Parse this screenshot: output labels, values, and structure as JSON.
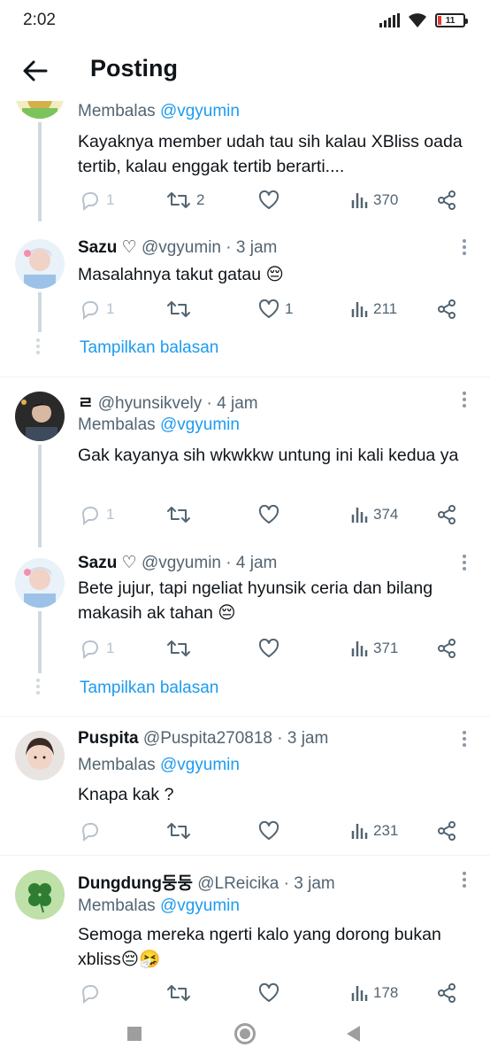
{
  "status_bar": {
    "time": "2:02",
    "battery": "11"
  },
  "header": {
    "title": "Posting"
  },
  "replies": [
    {
      "replying_prefix": "Membalas",
      "replying_handle": "@vgyumin",
      "text": "Kayaknya member udah tau sih kalau XBliss oada tertib, kalau enggak tertib berarti....",
      "stats": {
        "replies": "1",
        "retweets": "2",
        "likes": "",
        "views": "370"
      }
    },
    {
      "name": "Sazu ♡",
      "handle": "@vgyumin",
      "time": "· 3 jam",
      "text": "Masalahnya takut gatau 😔",
      "stats": {
        "replies": "1",
        "retweets": "",
        "likes": "1",
        "views": "211"
      },
      "show_replies": "Tampilkan balasan"
    },
    {
      "name": "ㄹ",
      "handle": "@hyunsikvely",
      "time": "· 4 jam",
      "replying_prefix": "Membalas",
      "replying_handle": "@vgyumin",
      "text": "Gak kayanya sih wkwkkw untung ini kali kedua ya",
      "stats": {
        "replies": "1",
        "retweets": "",
        "likes": "",
        "views": "374"
      }
    },
    {
      "name": "Sazu ♡",
      "handle": "@vgyumin",
      "time": "· 4 jam",
      "text": "Bete jujur, tapi ngeliat hyunsik ceria dan bilang makasih ak tahan 😔",
      "stats": {
        "replies": "1",
        "retweets": "",
        "likes": "",
        "views": "371"
      },
      "show_replies": "Tampilkan balasan"
    },
    {
      "name": "Puspita",
      "handle": "@Puspita270818",
      "time": "· 3 jam",
      "replying_prefix": "Membalas",
      "replying_handle": "@vgyumin",
      "text": "Knapa kak ?",
      "stats": {
        "replies": "",
        "retweets": "",
        "likes": "",
        "views": "231"
      }
    },
    {
      "name": "Dungdung둥둥",
      "handle": "@LReicika",
      "time": "· 3 jam",
      "replying_prefix": "Membalas",
      "replying_handle": "@vgyumin",
      "text": "Semoga mereka ngerti kalo yang dorong bukan xbliss😔🤧",
      "stats": {
        "replies": "",
        "retweets": "",
        "likes": "",
        "views": "178"
      }
    }
  ],
  "colors": {
    "accent": "#1d9bf0",
    "text": "#0f1419",
    "muted": "#536471",
    "thread": "#cfd9de"
  },
  "icons": [
    "back-arrow-icon",
    "reply-icon",
    "retweet-icon",
    "like-icon",
    "views-icon",
    "share-icon",
    "more-icon"
  ]
}
